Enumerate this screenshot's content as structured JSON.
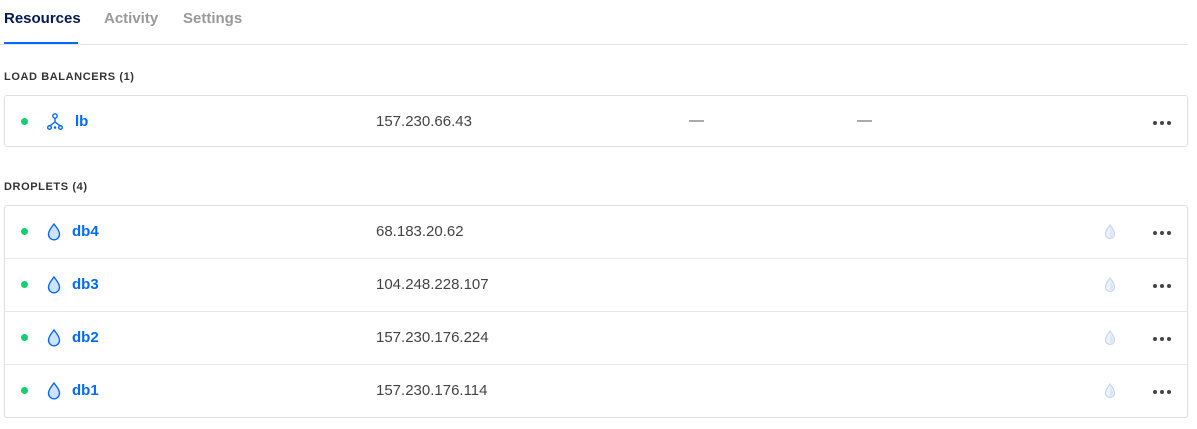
{
  "tabs": [
    {
      "label": "Resources",
      "active": true
    },
    {
      "label": "Activity",
      "active": false
    },
    {
      "label": "Settings",
      "active": false
    }
  ],
  "load_balancers": {
    "title": "LOAD BALANCERS (1)",
    "items": [
      {
        "name": "lb",
        "ip": "157.230.66.43",
        "col3": "—",
        "col4": "—",
        "status": "active",
        "icon": "load-balancer-icon"
      }
    ]
  },
  "droplets": {
    "title": "DROPLETS (4)",
    "items": [
      {
        "name": "db4",
        "ip": "68.183.20.62",
        "status": "active",
        "icon": "droplet-icon"
      },
      {
        "name": "db3",
        "ip": "104.248.228.107",
        "status": "active",
        "icon": "droplet-icon"
      },
      {
        "name": "db2",
        "ip": "157.230.176.224",
        "status": "active",
        "icon": "droplet-icon"
      },
      {
        "name": "db1",
        "ip": "157.230.176.114",
        "status": "active",
        "icon": "droplet-icon"
      }
    ]
  },
  "colors": {
    "accent": "#0069ff",
    "status_active": "#15cd72",
    "nav_active": "#031b4e"
  }
}
